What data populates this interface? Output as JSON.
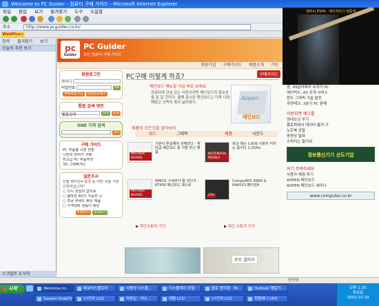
{
  "window": {
    "title": "Welcome to PC Guider - 컴퓨터 구매 가이드 - Microsoft Internet Explorer"
  },
  "menu": [
    "파일",
    "편집",
    "보기",
    "즐겨찾기",
    "도구",
    "도움말"
  ],
  "address": {
    "label": "주소",
    "url": "http://www.pcguider.co.kr/"
  },
  "linkbar": {
    "badge": "WebPlus+"
  },
  "sidebar": {
    "tabs": [
      "검색",
      "즐겨찾기",
      "보기"
    ],
    "header": "오늘의 추천 보기",
    "footer": "스크립트 도우미"
  },
  "site": {
    "brand": "PC Guider",
    "logo_letters": "pc",
    "logo_sub": "Guider",
    "tagline": "최신 컴퓨터 구매 가이드",
    "nav": [
      "회원가입",
      "구매가이드",
      "제품소개",
      "기타"
    ],
    "login": {
      "title": "회원로그인",
      "id_label": "아이디",
      "pw_label": "비밀번호",
      "ok": "OK",
      "join": "무료회원가입",
      "find": "비밀번호찾기"
    },
    "search": {
      "title": "통합 검색 엔진",
      "select": "통합검색",
      "go": "검색",
      "detail": "상세"
    },
    "price": {
      "title": "ONE 가격 검색",
      "go": "GO"
    },
    "guide": {
      "title": "구매 가이드",
      "items": [
        "PC 부품별 시장 전망",
        "나만의 최저가 구매",
        "최고급 PC 부품추천",
        "3D 그래픽카드"
      ]
    },
    "poll": {
      "title": "설문조사",
      "question": "인텔 펜티엄4 칩셋 중 어떤 것을 가장 선호하십니까?",
      "options": [
        "다시 관심이 없어요",
        "올바른 AS가 가능한 곳",
        "조금 비싸도 좋은 제품",
        "가격대비 성능이 좋은"
      ],
      "vote": "투표하기",
      "result": "결과보기"
    }
  },
  "hero": {
    "title": "PC구매 이렇게 하죠?",
    "badge": "구매가이드",
    "red": "메인보드 매뉴얼 지금 바로 보세요",
    "text": "컴퓨터에 관심 있는 사람이라면 메인보드의 중요성을 잘 알 것이다. 올해 출시된 메인보드는 더욱 다양해졌고 선택의 폭이 넓어졌다.",
    "image_label": "메인보드",
    "image_brand": "Aopen"
  },
  "products": {
    "section_title": "제품의 모든것을 알아보자",
    "tabs": [
      "보드",
      "그래픽",
      "제품",
      "사운드"
    ],
    "cards": [
      {
        "label": "MOTHER BOARD",
        "text": "기본이 튼실해야 강해진다 - 환타급 메인보드 중 가장 최신 제품"
      },
      {
        "label": "NOTEBOOK MOBILE",
        "text": "최근 에는 노트북 시장이 커지는 중이다 2.2GHz"
      },
      {
        "label": "MOTHER BOARD",
        "text": "AMD의 구세주가 될 것인가 - KT400 메인보드 테스트"
      },
      {
        "label": "CPU",
        "text": "CompuREX 486A & P4A533 펜티엄4"
      }
    ],
    "more_left": "최근스토리 기기",
    "more_right": "최근 스토리 기기"
  },
  "banners": {
    "right_text": "포토 갤러리"
  },
  "right": {
    "items": [
      "콤, 99달러짜리 초저가 PC",
      "에이럭스, AS 공개 서비스",
      "윈도 그래픽 기술 발전",
      "주연테크, 3분기 PC 판매"
    ],
    "section1": "이번지면 예고를",
    "list1": [
      "원내소년 우기",
      "플로피에서 데이터 옮겨 가",
      "노트북 관찰",
      "동영상 발표",
      "스피커는 즐거워"
    ],
    "box": "정보통신기기 선도기업",
    "section2": "여기 주목하세요",
    "list2": [
      "사용자 체험 후기",
      "AOPEN 메인보드",
      "AOPEN 메인보드 세미나"
    ],
    "url": "www.computer.co.kr"
  },
  "video": {
    "osd": "엠비씨 ESPN · 메이저리그 생중계"
  },
  "status": {
    "zone": "인터넷"
  },
  "taskbar": {
    "start": "시작",
    "tasks": [
      "Welcome to...",
      "파워익스플로러",
      "사용자 디스플...",
      "디스플레이 모델",
      "블로 편지함 - M...",
      "Outlook 메일가...",
      "Sasami GrabTV",
      "17인치 LCD",
      "자동입 - 아스...",
      "대형 LCD",
      "17인치 LCD",
      "회형테니 UFO"
    ],
    "time": "오후 1:25",
    "day": "화요일",
    "date": "2002-10-29"
  }
}
